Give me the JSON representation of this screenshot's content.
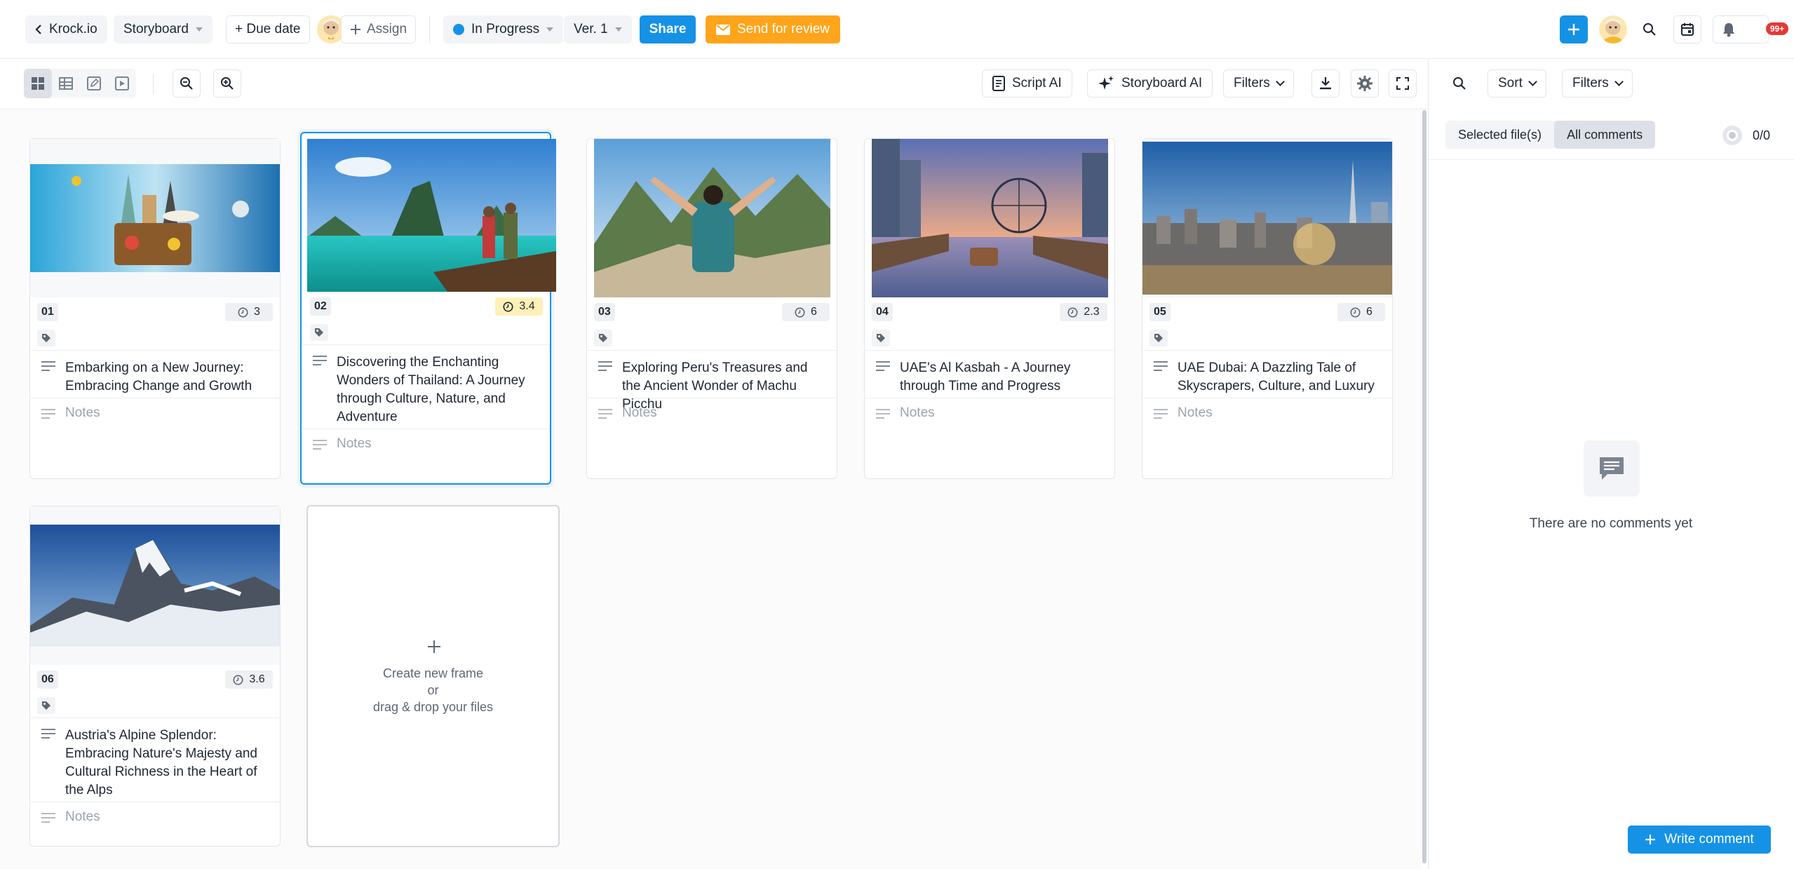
{
  "topbar": {
    "back_label": "Krock.io",
    "view_select": "Storyboard",
    "due_date": "+ Due date",
    "assign": "Assign",
    "status": "In Progress",
    "version": "Ver. 1",
    "share": "Share",
    "send_review": "Send for review",
    "notif_count": "99+"
  },
  "toolbar": {
    "script_ai": "Script AI",
    "storyboard_ai": "Storyboard AI",
    "filters": "Filters"
  },
  "frames": [
    {
      "number": "01",
      "duration": "3",
      "script": "Embarking on a New Journey: Embracing Change and Growth",
      "notes": "Notes",
      "highlight": false
    },
    {
      "number": "02",
      "duration": "3.4",
      "script": "Discovering the Enchanting Wonders of Thailand: A Journey through Culture, Nature, and Adventure",
      "notes": "Notes",
      "highlight": true
    },
    {
      "number": "03",
      "duration": "6",
      "script": "Exploring Peru's Treasures and the Ancient Wonder of Machu Picchu",
      "notes": "Notes",
      "highlight": false
    },
    {
      "number": "04",
      "duration": "2.3",
      "script": "UAE's Al Kasbah - A Journey through Time and Progress",
      "notes": "Notes",
      "highlight": false
    },
    {
      "number": "05",
      "duration": "6",
      "script": "UAE Dubai: A Dazzling Tale of Skyscrapers, Culture, and Luxury",
      "notes": "Notes",
      "highlight": false
    },
    {
      "number": "06",
      "duration": "3.6",
      "script": "Austria's Alpine Splendor: Embracing Nature's Majesty and Cultural Richness in the Heart of the Alps",
      "notes": "Notes",
      "highlight": false
    }
  ],
  "new_frame": {
    "line1": "Create new frame",
    "line2": "or",
    "line3": "drag & drop your files"
  },
  "panel": {
    "sort": "Sort",
    "filters": "Filters",
    "tab_selected": "Selected file(s)",
    "tab_all": "All comments",
    "counter": "0/0",
    "empty": "There are no comments yet",
    "write_comment": "Write comment"
  },
  "colors": {
    "primary": "#1592e6",
    "review": "#ffa41b",
    "badge": "#e53935",
    "highlight": "#fff0b8"
  }
}
